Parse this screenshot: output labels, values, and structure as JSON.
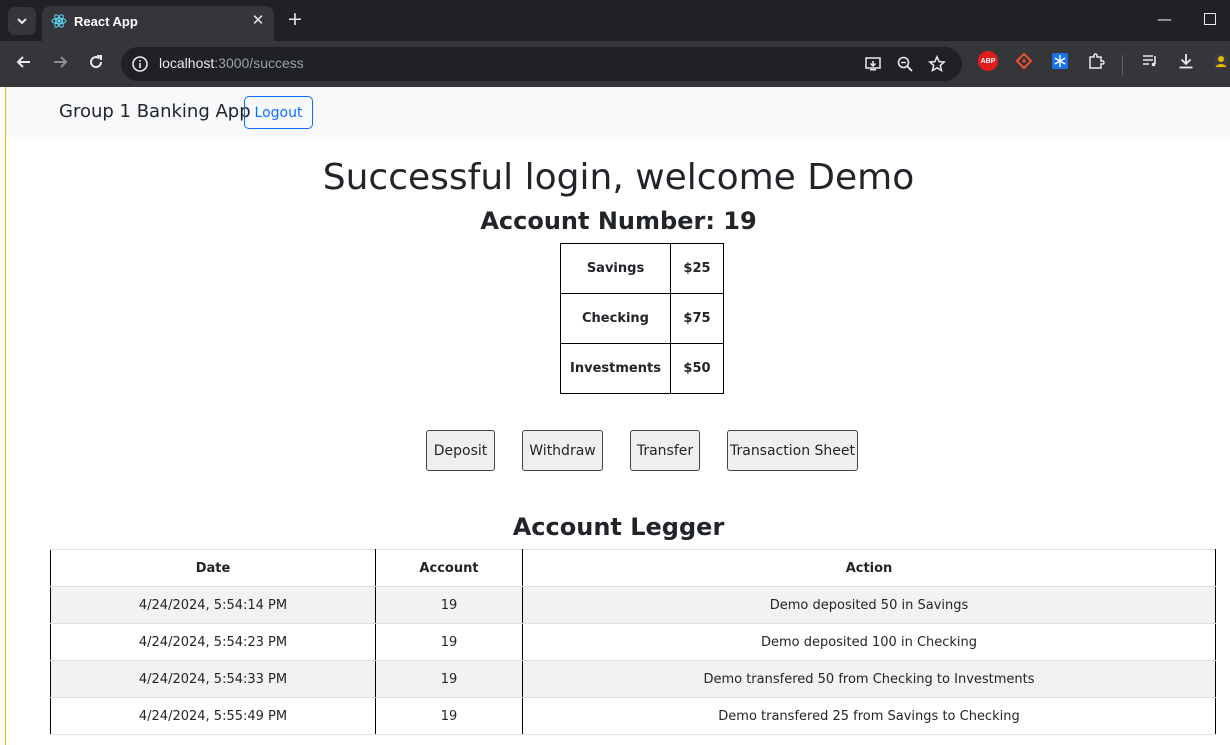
{
  "browser": {
    "tab_title": "React App",
    "url_host": "localhost",
    "url_path": ":3000/success",
    "extensions": [
      "adblock-plus-icon",
      "git-extension-icon",
      "snowflake-extension-icon",
      "puzzle-icon"
    ],
    "abp_label": "ABP"
  },
  "navbar": {
    "brand": "Group 1 Banking App",
    "logout_label": "Logout"
  },
  "main": {
    "welcome": "Successful login, welcome Demo",
    "account_number": "Account Number: 19",
    "balances": [
      {
        "name": "Savings",
        "amount": "$25"
      },
      {
        "name": "Checking",
        "amount": "$75"
      },
      {
        "name": "Investments",
        "amount": "$50"
      }
    ],
    "actions": [
      "Deposit",
      "Withdraw",
      "Transfer",
      "Transaction Sheet"
    ]
  },
  "ledger": {
    "title": "Account Legger",
    "headers": [
      "Date",
      "Account",
      "Action"
    ],
    "rows": [
      {
        "date": "4/24/2024, 5:54:14 PM",
        "account": "19",
        "action": "Demo deposited 50 in Savings"
      },
      {
        "date": "4/24/2024, 5:54:23 PM",
        "account": "19",
        "action": "Demo deposited 100 in Checking"
      },
      {
        "date": "4/24/2024, 5:54:33 PM",
        "account": "19",
        "action": "Demo transfered 50 from Checking to Investments"
      },
      {
        "date": "4/24/2024, 5:55:49 PM",
        "account": "19",
        "action": "Demo transfered 25 from Savings to Checking"
      }
    ]
  },
  "colors": {
    "primary": "#0d6efd",
    "navbar_bg": "#f8f9fa",
    "chrome_dark": "#202124",
    "chrome_toolbar": "#35363a"
  }
}
